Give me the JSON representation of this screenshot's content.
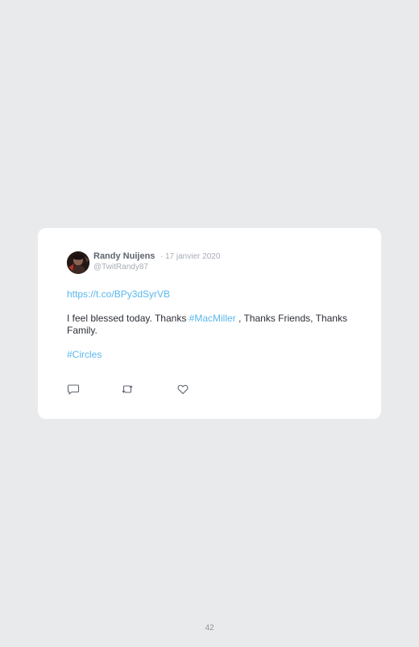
{
  "tweet": {
    "author_name": "Randy Nuijens",
    "separator": "·",
    "date": "17 janvier 2020",
    "handle": "@TwitRandy87",
    "link": "https://t.co/BPy3dSyrVB",
    "text_part1": "I feel blessed today. Thanks ",
    "mention_tag": "#MacMiller",
    "text_part2": " , Thanks Friends, Thanks Family.",
    "hashtag": "#Circles",
    "actions": {
      "reply_icon": "comment-icon",
      "retweet_icon": "retweet-icon",
      "like_icon": "heart-icon"
    }
  },
  "colors": {
    "background": "#e9eaec",
    "card": "#ffffff",
    "link": "#5bb8ec",
    "muted": "#a7adb6",
    "author": "#5d6470",
    "text": "#2b2f36"
  },
  "page": {
    "number": "42"
  }
}
